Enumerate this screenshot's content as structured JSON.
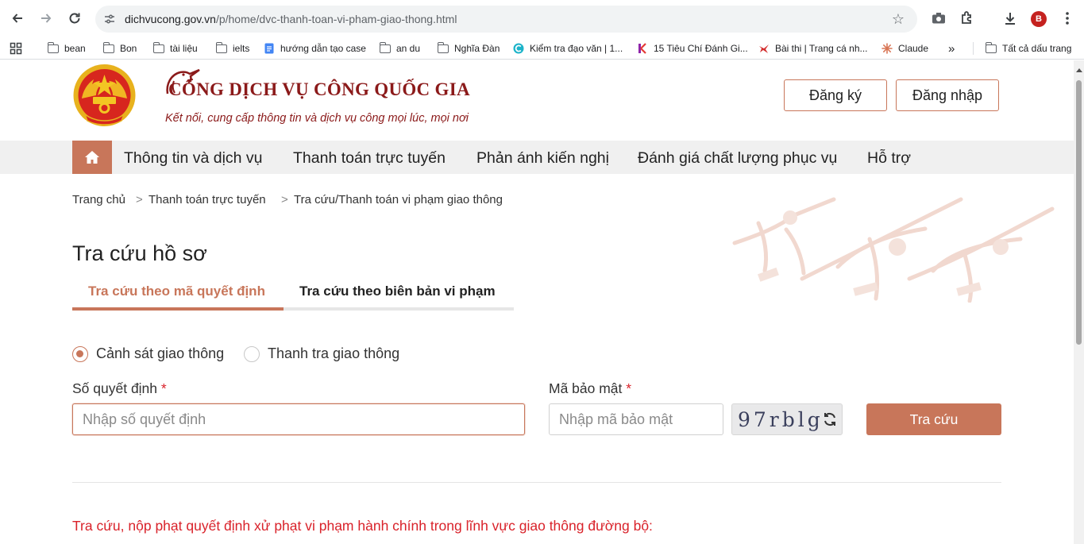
{
  "browser": {
    "url_host": "dichvucong.gov.vn",
    "url_path": "/p/home/dvc-thanh-toan-vi-pham-giao-thong.html",
    "avatar_letter": "B",
    "bookmarks": [
      "bean",
      "Bon",
      "tài liệu",
      "ielts",
      "hướng dẫn tạo case",
      "an du",
      "Nghĩa Đàn",
      "Kiểm tra đạo văn | 1...",
      "15 Tiêu Chí Đánh Gi...",
      "Bài thi | Trang cá nh...",
      "Claude"
    ],
    "more_bookmarks": "»",
    "all_bookmarks": "Tất cả dấu trang"
  },
  "header": {
    "site_title": "CỔNG DỊCH VỤ CÔNG QUỐC GIA",
    "site_subtitle": "Kết nối, cung cấp thông tin và dịch vụ công mọi lúc, mọi nơi",
    "register": "Đăng ký",
    "login": "Đăng nhập"
  },
  "nav": {
    "items": [
      "Thông tin và dịch vụ",
      "Thanh toán trực tuyến",
      "Phản ánh kiến nghị",
      "Đánh giá chất lượng phục vụ",
      "Hỗ trợ"
    ]
  },
  "breadcrumb": [
    "Trang chủ",
    "Thanh toán trực tuyến",
    "Tra cứu/Thanh toán vi phạm giao thông"
  ],
  "main": {
    "title": "Tra cứu hồ sơ",
    "tabs": [
      "Tra cứu theo mã quyết định",
      "Tra cứu theo biên bản vi phạm"
    ],
    "radios": [
      "Cảnh sát giao thông",
      "Thanh tra giao thông"
    ],
    "decision_label": "Số quyết định",
    "decision_placeholder": "Nhập số quyết định",
    "captcha_label": "Mã bảo mật",
    "captcha_placeholder": "Nhập mã bảo mật",
    "captcha_code": "97rblg",
    "search_button": "Tra cứu",
    "required_mark": "*",
    "note_line1": "Tra cứu, nộp phạt quyết định xử phạt vi phạm hành chính trong lĩnh vực giao thông đường bộ:"
  },
  "colors": {
    "brand": "#c8765a",
    "title_red": "#8b1a1a",
    "required": "#d9222a"
  }
}
